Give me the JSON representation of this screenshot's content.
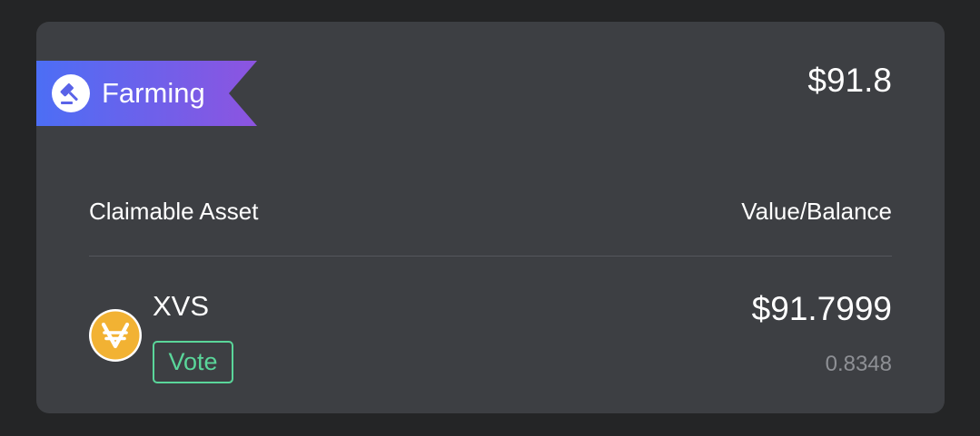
{
  "section": {
    "tag_label": "Farming",
    "tag_icon": "gavel-icon",
    "total_value": "$91.8"
  },
  "table": {
    "header_left": "Claimable Asset",
    "header_right": "Value/Balance",
    "rows": [
      {
        "symbol": "XVS",
        "logo_icon": "xvs-token-icon",
        "badge": "Vote",
        "value": "$91.7999",
        "balance": "0.8348"
      }
    ]
  },
  "colors": {
    "page_bg": "#242526",
    "card_bg": "#3d3f43",
    "ribbon_gradient_start": "#4c6ef5",
    "ribbon_gradient_end": "#8d54e0",
    "badge_green": "#5ad69a",
    "token_gold": "#f2b233",
    "muted_text": "#8e9095"
  }
}
